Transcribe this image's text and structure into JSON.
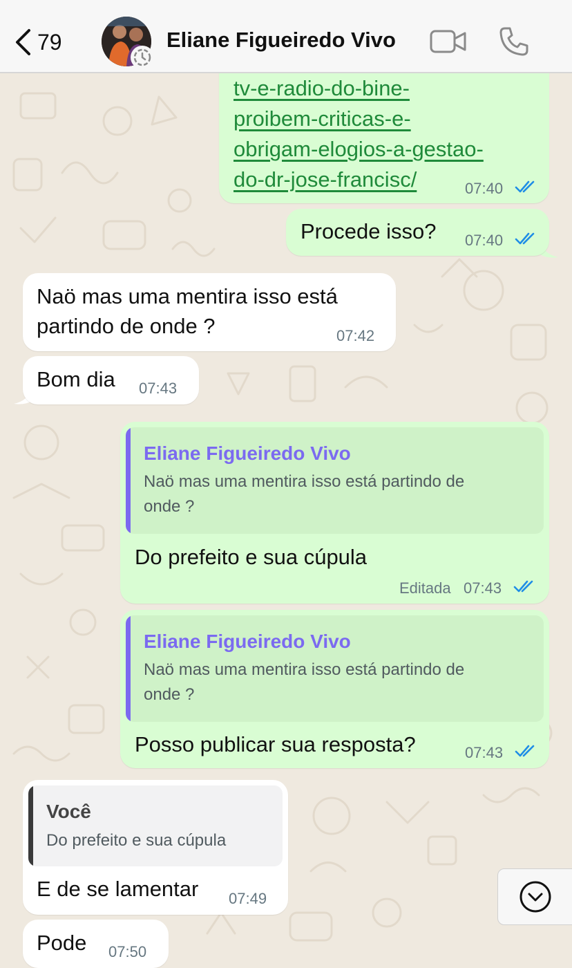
{
  "header": {
    "back_count": "79",
    "contact_name": "Eliane Figueiredo Vivo"
  },
  "icons": {
    "back": "chevron-left",
    "video": "video-camera",
    "call": "phone",
    "status": "status-ring",
    "scroll_down": "chevron-down-circle"
  },
  "colors": {
    "outgoing_bubble": "#d9fdd3",
    "incoming_bubble": "#ffffff",
    "link": "#1f8a3a",
    "read_ticks": "#1f8de6",
    "quote_name": "#7b6af0"
  },
  "messages": [
    {
      "direction": "out",
      "link_lines": [
        "tv-e-radio-do-bine-",
        "proibem-criticas-e-",
        "obrigam-elogios-a-gestao-",
        "do-dr-jose-francisc/"
      ],
      "time": "07:40",
      "status": "read"
    },
    {
      "direction": "out",
      "text": "Procede isso?",
      "time": "07:40",
      "status": "read"
    },
    {
      "direction": "in",
      "text_lines": [
        "Naö mas uma mentira isso está",
        "partindo de onde ?"
      ],
      "time": "07:42"
    },
    {
      "direction": "in",
      "text": "Bom dia",
      "time": "07:43"
    },
    {
      "direction": "out",
      "quote": {
        "author": "Eliane Figueiredo Vivo",
        "text_lines": [
          "Naö mas uma mentira isso está partindo de",
          "onde ?"
        ]
      },
      "text": "Do prefeito e sua cúpula",
      "edited": "Editada",
      "time": "07:43",
      "status": "read"
    },
    {
      "direction": "out",
      "quote": {
        "author": "Eliane Figueiredo Vivo",
        "text_lines": [
          "Naö mas uma mentira isso está partindo de",
          "onde ?"
        ]
      },
      "text": "Posso publicar sua resposta?",
      "time": "07:43",
      "status": "read"
    },
    {
      "direction": "in",
      "quote": {
        "author": "Você",
        "text": "Do prefeito e sua cúpula"
      },
      "text": "E de se lamentar",
      "time": "07:49"
    },
    {
      "direction": "in",
      "text": "Pode",
      "time": "07:50"
    }
  ]
}
